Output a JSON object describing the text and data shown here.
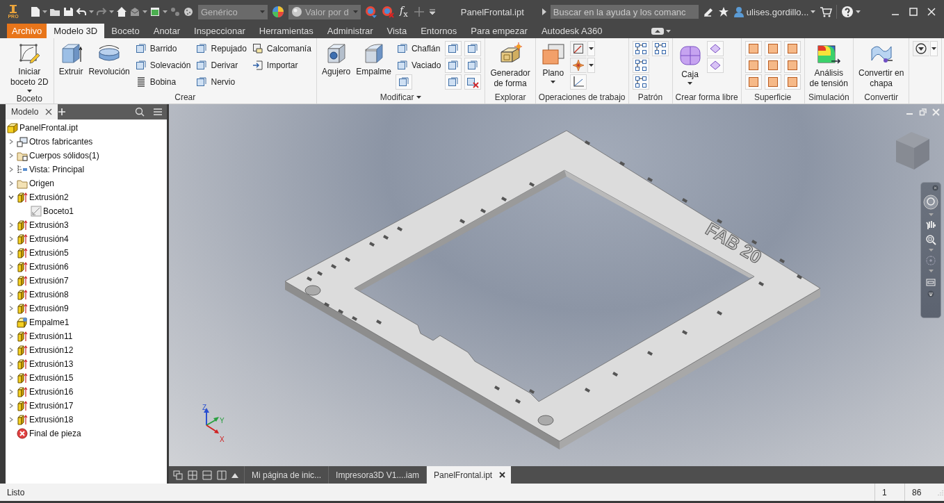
{
  "title_bar": {
    "logo_edition": "PRO",
    "material": "Genérico",
    "appearance": "Valor por d",
    "function_button": "*f*$_{x}$",
    "document_title": "PanelFrontal.ipt",
    "search": {
      "placeholder": "Buscar en la ayuda y los comanc"
    },
    "user": "ulises.gordillo..."
  },
  "ribbon_tabs": [
    {
      "label": "Archivo",
      "kind": "file",
      "selected": false
    },
    {
      "label": "Modelo 3D",
      "kind": "tab",
      "selected": true
    },
    {
      "label": "Boceto",
      "kind": "tab",
      "selected": false
    },
    {
      "label": "Anotar",
      "kind": "tab",
      "selected": false
    },
    {
      "label": "Inspeccionar",
      "kind": "tab",
      "selected": false
    },
    {
      "label": "Herramientas",
      "kind": "tab",
      "selected": false
    },
    {
      "label": "Administrar",
      "kind": "tab",
      "selected": false
    },
    {
      "label": "Vista",
      "kind": "tab",
      "selected": false
    },
    {
      "label": "Entornos",
      "kind": "tab",
      "selected": false
    },
    {
      "label": "Para empezar",
      "kind": "tab",
      "selected": false
    },
    {
      "label": "Autodesk A360",
      "kind": "tab",
      "selected": false
    }
  ],
  "ribbon_panels": [
    {
      "title": "Boceto",
      "menu": false,
      "groups": [
        {
          "tools": [
            {
              "kind": "large",
              "label": "Iniciar\nboceto 2D",
              "dropdown": true
            }
          ]
        }
      ]
    },
    {
      "title": "Crear",
      "menu": false,
      "groups": [
        {
          "tools": [
            {
              "kind": "large",
              "label": "Extruir",
              "dropdown": false
            }
          ]
        },
        {
          "tools": [
            {
              "kind": "large",
              "label": "Revolución",
              "dropdown": false
            }
          ]
        },
        {
          "tools": [
            {
              "kind": "small",
              "label": "Barrido"
            },
            {
              "kind": "small",
              "label": "Solevación"
            },
            {
              "kind": "small",
              "label": "Bobina"
            }
          ]
        },
        {
          "tools": [
            {
              "kind": "small",
              "label": "Repujado"
            },
            {
              "kind": "small",
              "label": "Derivar"
            },
            {
              "kind": "small",
              "label": "Nervio"
            }
          ]
        },
        {
          "tools": [
            {
              "kind": "small",
              "label": "Calcomanía"
            },
            {
              "kind": "small",
              "label": "Importar"
            }
          ]
        }
      ]
    },
    {
      "title": "Modificar",
      "menu": true,
      "groups": [
        {
          "tools": [
            {
              "kind": "large",
              "label": "Agujero",
              "dropdown": false
            }
          ]
        },
        {
          "tools": [
            {
              "kind": "large",
              "label": "Empalme",
              "dropdown": false
            }
          ]
        },
        {
          "tools": [
            {
              "kind": "small",
              "label": "Chaflán"
            },
            {
              "kind": "small",
              "label": "Vaciado"
            },
            {
              "kind": "icon",
              "dropdown": false
            }
          ]
        },
        {
          "tools": [
            {
              "kind": "icon",
              "dropdown": false
            },
            {
              "kind": "icon",
              "dropdown": false
            },
            {
              "kind": "icon",
              "dropdown": false
            }
          ]
        },
        {
          "tools": [
            {
              "kind": "icon",
              "dropdown": false
            },
            {
              "kind": "icon",
              "dropdown": false
            },
            {
              "kind": "icon",
              "dropdown": false
            }
          ]
        }
      ]
    },
    {
      "title": "Explorar",
      "menu": false,
      "groups": [
        {
          "tools": [
            {
              "kind": "large",
              "label": "Generador\nde forma",
              "dropdown": false
            }
          ]
        }
      ]
    },
    {
      "title": "Operaciones de trabajo",
      "menu": false,
      "groups": [
        {
          "tools": [
            {
              "kind": "large",
              "label": "Plano",
              "dropdown": true
            }
          ]
        },
        {
          "tools": [
            {
              "kind": "icon",
              "dropdown": true
            },
            {
              "kind": "icon",
              "dropdown": true
            },
            {
              "kind": "icon",
              "dropdown": false
            }
          ]
        }
      ]
    },
    {
      "title": "Patrón",
      "menu": false,
      "groups": [
        {
          "tools": [
            {
              "kind": "icon",
              "dropdown": false
            },
            {
              "kind": "icon",
              "dropdown": false
            },
            {
              "kind": "icon",
              "dropdown": false
            }
          ]
        },
        {
          "tools": [
            {
              "kind": "icon",
              "dropdown": false
            }
          ]
        }
      ]
    },
    {
      "title": "Crear forma libre",
      "menu": false,
      "groups": [
        {
          "tools": [
            {
              "kind": "large",
              "label": "Caja",
              "dropdown": true
            }
          ]
        },
        {
          "tools": [
            {
              "kind": "icon",
              "dropdown": false
            },
            {
              "kind": "icon",
              "dropdown": false
            }
          ]
        }
      ]
    },
    {
      "title": "Superficie",
      "menu": false,
      "groups": [
        {
          "tools": [
            {
              "kind": "icon",
              "dropdown": false
            },
            {
              "kind": "icon",
              "dropdown": false
            },
            {
              "kind": "icon",
              "dropdown": false
            }
          ]
        },
        {
          "tools": [
            {
              "kind": "icon",
              "dropdown": false
            },
            {
              "kind": "icon",
              "dropdown": false
            },
            {
              "kind": "icon",
              "dropdown": false
            }
          ]
        },
        {
          "tools": [
            {
              "kind": "icon",
              "dropdown": false
            },
            {
              "kind": "icon",
              "dropdown": false
            },
            {
              "kind": "icon",
              "dropdown": false
            }
          ]
        }
      ]
    },
    {
      "title": "Simulación",
      "menu": false,
      "groups": [
        {
          "tools": [
            {
              "kind": "large",
              "label": "Análisis\nde tensión",
              "dropdown": false
            }
          ]
        }
      ]
    },
    {
      "title": "Convertir",
      "menu": false,
      "groups": [
        {
          "tools": [
            {
              "kind": "large",
              "label": "Convertir en\nchapa",
              "dropdown": false
            }
          ]
        }
      ]
    },
    {
      "groups": [
        {
          "tools": [
            {
              "kind": "icon",
              "dropdown": true
            }
          ]
        }
      ]
    }
  ],
  "browser": {
    "tabs": [
      {
        "label": "Modelo",
        "selected": true
      }
    ],
    "tree": [
      {
        "label": "PanelFrontal.ipt",
        "kind": "part",
        "children": [
          {
            "label": "Otros fabricantes",
            "kind": "third-party",
            "expanded": false
          },
          {
            "label": "Cuerpos sólidos(1)",
            "kind": "solid-bodies",
            "expanded": false
          },
          {
            "label": "Vista: Principal",
            "kind": "view",
            "expanded": false
          },
          {
            "label": "Origen",
            "kind": "folder",
            "expanded": false
          },
          {
            "label": "Extrusión2",
            "kind": "extrusion",
            "expanded": true,
            "children": [
              {
                "label": "Boceto1",
                "kind": "sketch"
              }
            ]
          },
          {
            "label": "Extrusión3",
            "kind": "extrusion",
            "expanded": false
          },
          {
            "label": "Extrusión4",
            "kind": "extrusion",
            "expanded": false
          },
          {
            "label": "Extrusión5",
            "kind": "extrusion",
            "expanded": false
          },
          {
            "label": "Extrusión6",
            "kind": "extrusion",
            "expanded": false
          },
          {
            "label": "Extrusión7",
            "kind": "extrusion",
            "expanded": false
          },
          {
            "label": "Extrusión8",
            "kind": "extrusion",
            "expanded": false
          },
          {
            "label": "Extrusión9",
            "kind": "extrusion",
            "expanded": false
          },
          {
            "label": "Empalme1",
            "kind": "fillet"
          },
          {
            "label": "Extrusión11",
            "kind": "extrusion",
            "expanded": false
          },
          {
            "label": "Extrusión12",
            "kind": "extrusion",
            "expanded": false
          },
          {
            "label": "Extrusión13",
            "kind": "extrusion",
            "expanded": false
          },
          {
            "label": "Extrusión15",
            "kind": "extrusion",
            "expanded": false
          },
          {
            "label": "Extrusión16",
            "kind": "extrusion",
            "expanded": false
          },
          {
            "label": "Extrusión17",
            "kind": "extrusion",
            "expanded": false
          },
          {
            "label": "Extrusión18",
            "kind": "extrusion",
            "expanded": false
          },
          {
            "label": "Final de pieza",
            "kind": "end"
          }
        ]
      }
    ]
  },
  "viewport": {
    "engraving": "FAB 20",
    "axis_labels": [
      {
        "label": "Z",
        "kind": "z"
      },
      {
        "label": "Y",
        "kind": "y"
      },
      {
        "label": "X",
        "kind": "x"
      }
    ]
  },
  "document_tabs": [
    {
      "label": "Mi página de inic...",
      "selected": false,
      "closable": false
    },
    {
      "label": "Impresora3D V1....iam",
      "selected": false,
      "closable": false
    },
    {
      "label": "PanelFrontal.ipt",
      "selected": true,
      "closable": true
    }
  ],
  "status_bar": {
    "message": "Listo",
    "cells": [
      "1",
      "86"
    ]
  }
}
